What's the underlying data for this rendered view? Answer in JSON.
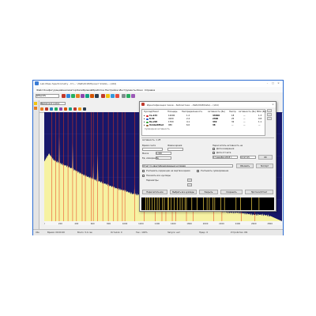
{
  "app": {
    "title": "Lab Mass Spectrometry - D:\\... \\Лаб\\2018\\Проект \\Data\\... (x64)",
    "menu": [
      "Файл",
      "Конфигурация",
      "Анализатор",
      "Калибровка",
      "Обработка",
      "Настройки",
      "Инструменты",
      "Окно",
      "Справка"
    ],
    "toolbar_select": "Background control",
    "toolbar_mode": "SPEw/CPS",
    "status_items": [
      "Idle",
      "Время: 00:00:00",
      "Всего: 5.4 сек",
      "Остался: 0",
      "Тек.: 100%",
      "Запуск: нет",
      "Пред.: 0",
      "Устройство: ON"
    ]
  },
  "dialog": {
    "title": "Идентификация пиков – библиотека ...Лаб\\2018\\Data\\... (x64)",
    "columns": [
      "Нуклид/Пакет",
      "Площадь",
      "Неопределенность",
      "Активность (Бк)",
      "Неопр.",
      "Активность (Бк)",
      "MDA (Бк)"
    ],
    "rows": [
      {
        "name": "Cs-134",
        "area": "12000",
        "unc": "1.2",
        "act": "43400",
        "unc2": "18",
        "act2": "—",
        "mda": "1.3"
      },
      {
        "name": "K-40",
        "area": "4100",
        "unc": "2.4",
        "act": "2300",
        "unc2": "25",
        "act2": "—",
        "mda": "0.8"
      },
      {
        "name": "Ra-226",
        "area": "1700",
        "unc": "4.1",
        "act": "440",
        "unc2": "32",
        "act2": "—",
        "mda": "1.1"
      },
      {
        "name": "Unidentified",
        "area": "980",
        "unc": "6.0",
        "act": "38",
        "unc2": "—",
        "act2": "—",
        "mda": "—"
      }
    ],
    "row_colors": [
      "#d62020",
      "#2050c8",
      "#30a030",
      "#8b5a2b"
    ],
    "summary_label": "Суммарная активность",
    "activity_label": "Активность: 1.2Е",
    "sections": {
      "count_time": "Время счета",
      "live_time": "Живое время",
      "calc_activity": "Пересчитать активность на",
      "date_label": "Дата измерения",
      "ref_date": "Дата отсчета",
      "units_label": "Ед. измерения",
      "units_value": "Бк",
      "time_label": "Время",
      "time_value": "13:27:15",
      "date_value": "17 декабря 2018 г.",
      "mass_label": "Масса",
      "mass_value": "1.000",
      "result_label": "Отчет по идентифицированным нуклидам",
      "check1": "Учитывать коррекции на мертвое время",
      "check2": "Учитывать суммирование",
      "check3": "Показать все нуклиды",
      "opt1": "Параметры"
    },
    "buttons": {
      "update": "Обновить",
      "save": "Сохранить",
      "export": "Экспорт",
      "calc_all": "Пересчитать все",
      "select_all": "Выбрать все нуклиды",
      "close": "Закрыть",
      "report": "Протокол/Отчет",
      "ok": "OK"
    }
  },
  "chart_data": {
    "type": "area",
    "title": "",
    "xlabel": "",
    "ylabel": "",
    "x_ticks": [
      "0",
      "200",
      "400",
      "600",
      "800",
      "1000",
      "1200",
      "1400",
      "1600",
      "1800",
      "2000",
      "2200",
      "2400",
      "2600",
      "2800"
    ],
    "fill_color": "#f6f2a2",
    "background_color": "#17176a",
    "marker_color": "#e83a1a",
    "x": [
      0,
      60,
      120,
      200,
      300,
      400,
      500,
      600,
      700,
      800,
      900,
      1000,
      1100,
      1200,
      1300,
      1400,
      1500,
      1600,
      1700,
      1800,
      1900,
      2000,
      2100,
      2200,
      2300,
      2400,
      2500,
      2600,
      2700,
      2800
    ],
    "values": [
      0.55,
      0.62,
      0.56,
      0.53,
      0.5,
      0.46,
      0.42,
      0.39,
      0.36,
      0.33,
      0.3,
      0.28,
      0.25,
      0.24,
      0.22,
      0.2,
      0.18,
      0.17,
      0.15,
      0.14,
      0.12,
      0.11,
      0.1,
      0.09,
      0.08,
      0.08,
      0.07,
      0.06,
      0.06,
      0.05
    ],
    "peaks": [
      {
        "x": 186,
        "v": 0.78
      },
      {
        "x": 352,
        "v": 0.72
      },
      {
        "x": 609,
        "v": 0.55
      },
      {
        "x": 662,
        "v": 0.62
      },
      {
        "x": 1120,
        "v": 0.34
      },
      {
        "x": 1460,
        "v": 0.42
      },
      {
        "x": 1764,
        "v": 0.22
      }
    ],
    "markers": [
      95,
      140,
      186,
      240,
      295,
      352,
      400,
      470,
      510,
      583,
      609,
      662,
      727,
      795,
      860,
      911,
      969,
      1001,
      1120,
      1238,
      1377,
      1460,
      1509,
      1588,
      1630,
      1764,
      1847,
      2103,
      2204,
      2447,
      2614
    ],
    "xlim": [
      0,
      2950
    ],
    "ylim": [
      0,
      1
    ]
  }
}
